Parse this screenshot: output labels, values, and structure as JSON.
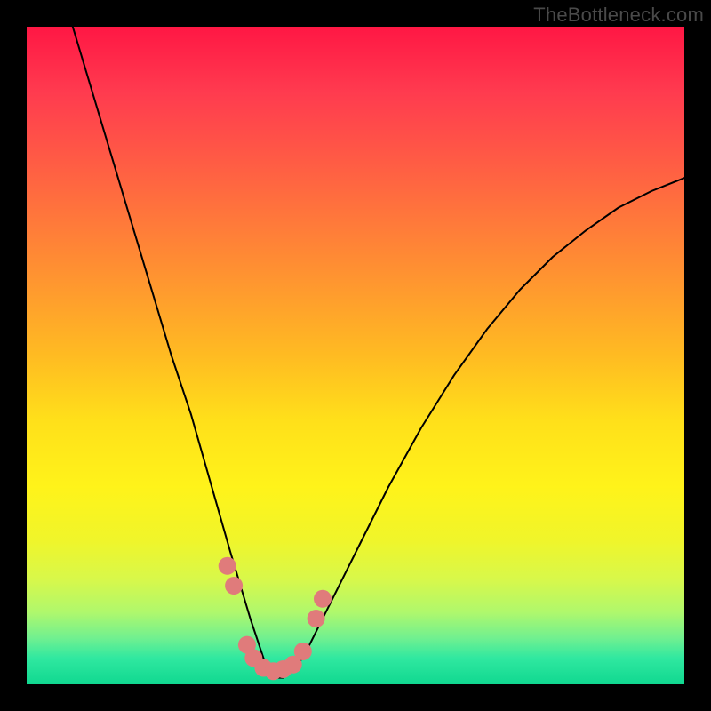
{
  "watermark": "TheBottleneck.com",
  "chart_data": {
    "type": "line",
    "title": "",
    "xlabel": "",
    "ylabel": "",
    "xlim": [
      0,
      100
    ],
    "ylim": [
      0,
      100
    ],
    "grid": false,
    "legend": false,
    "series": [
      {
        "name": "curve",
        "stroke": "#000000",
        "stroke_width": 2,
        "x": [
          7,
          10,
          13,
          16,
          19,
          22,
          25,
          27,
          29,
          31,
          32.5,
          34,
          35,
          36,
          37,
          38,
          39,
          40,
          42,
          44,
          46,
          50,
          55,
          60,
          65,
          70,
          75,
          80,
          85,
          90,
          95,
          100
        ],
        "y": [
          100,
          90,
          80,
          70,
          60,
          50,
          41,
          34,
          27,
          20,
          15,
          10,
          7,
          4,
          2,
          1,
          1,
          2,
          4,
          8,
          12,
          20,
          30,
          39,
          47,
          54,
          60,
          65,
          69,
          72.5,
          75,
          77
        ]
      },
      {
        "name": "markers",
        "type": "scatter",
        "fill": "#e07b7b",
        "points": [
          {
            "x": 30.5,
            "y": 18
          },
          {
            "x": 31.5,
            "y": 15
          },
          {
            "x": 33.5,
            "y": 6
          },
          {
            "x": 34.5,
            "y": 4
          },
          {
            "x": 36,
            "y": 2.5
          },
          {
            "x": 37.5,
            "y": 2
          },
          {
            "x": 39,
            "y": 2.3
          },
          {
            "x": 40.5,
            "y": 3
          },
          {
            "x": 42,
            "y": 5
          },
          {
            "x": 44,
            "y": 10
          },
          {
            "x": 45,
            "y": 13
          }
        ]
      }
    ],
    "background_gradient": {
      "top": "#ff1744",
      "mid": "#ffe01a",
      "bottom": "#10d890"
    }
  }
}
